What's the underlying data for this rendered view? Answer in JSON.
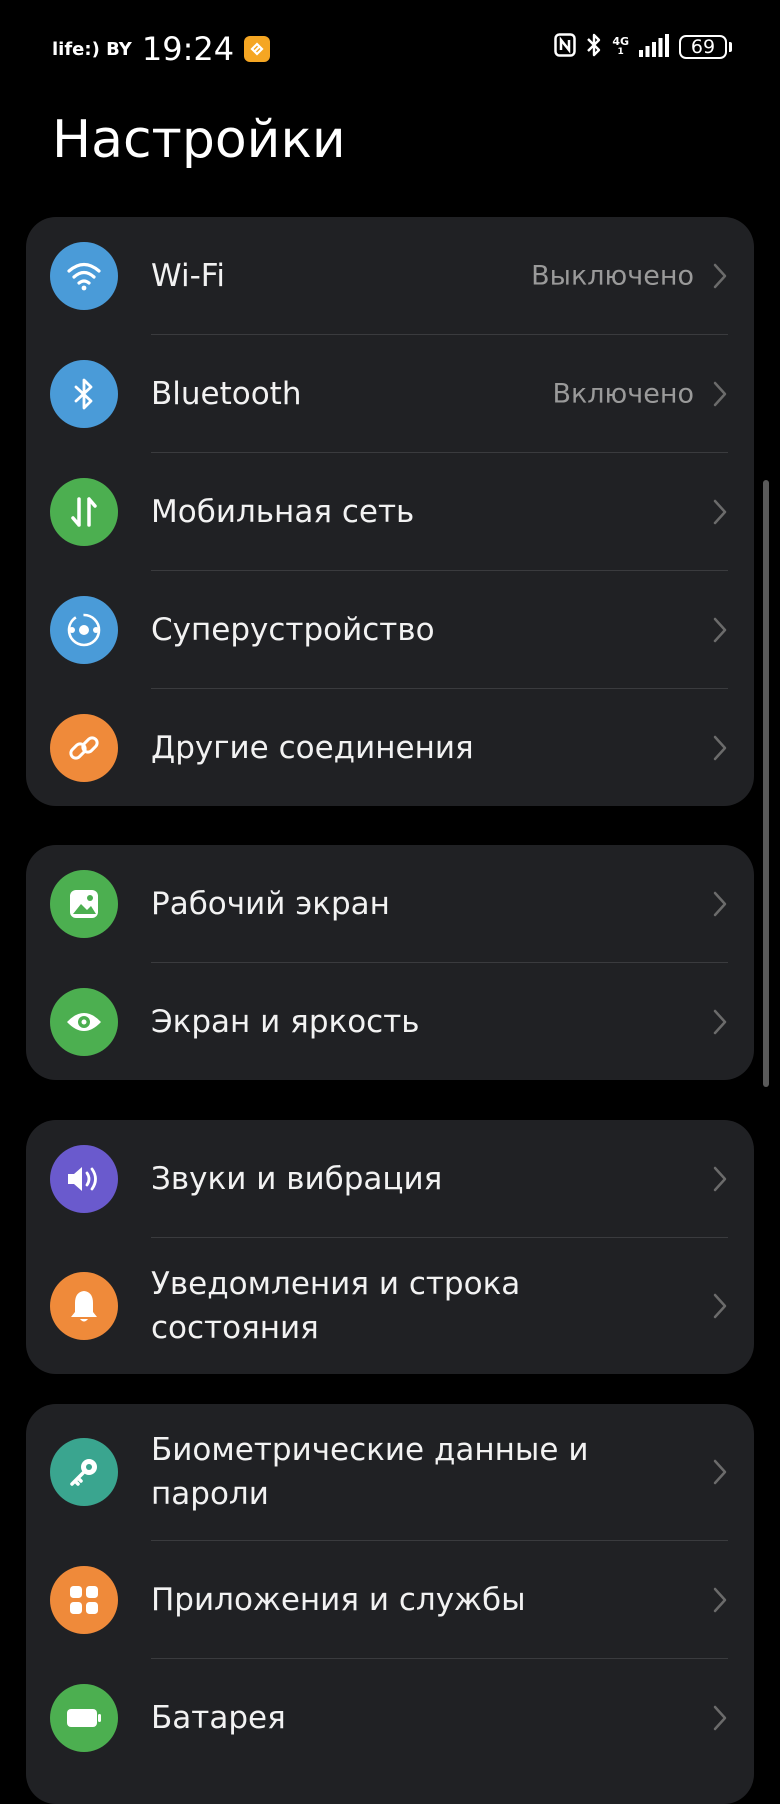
{
  "status_bar": {
    "carrier": "life:) BY",
    "time": "19:24",
    "network_type": "4G",
    "network_sub": "1",
    "battery_level": "69"
  },
  "page_title": "Настройки",
  "groups": [
    {
      "items": [
        {
          "label": "Wi-Fi",
          "value": "Выключено",
          "icon": "wifi-icon",
          "color": "#4a9bd8"
        },
        {
          "label": "Bluetooth",
          "value": "Включено",
          "icon": "bluetooth-icon",
          "color": "#4a9bd8"
        },
        {
          "label": "Мобильная сеть",
          "value": "",
          "icon": "mobile-data-icon",
          "color": "#4caf50"
        },
        {
          "label": "Суперустройство",
          "value": "",
          "icon": "super-device-icon",
          "color": "#4a9bd8"
        },
        {
          "label": "Другие соединения",
          "value": "",
          "icon": "link-icon",
          "color": "#ef8a3a"
        }
      ]
    },
    {
      "items": [
        {
          "label": "Рабочий экран",
          "value": "",
          "icon": "wallpaper-icon",
          "color": "#4caf50"
        },
        {
          "label": "Экран и яркость",
          "value": "",
          "icon": "eye-icon",
          "color": "#4caf50"
        }
      ]
    },
    {
      "items": [
        {
          "label": "Звуки и вибрация",
          "value": "",
          "icon": "sound-icon",
          "color": "#6a5acd"
        },
        {
          "label": "Уведомления и строка состояния",
          "value": "",
          "icon": "bell-icon",
          "color": "#ef8a3a"
        }
      ]
    },
    {
      "items": [
        {
          "label": "Биометрические данные и пароли",
          "value": "",
          "icon": "key-icon",
          "color": "#3aa58f"
        },
        {
          "label": "Приложения и службы",
          "value": "",
          "icon": "apps-icon",
          "color": "#ef8a3a"
        },
        {
          "label": "Батарея",
          "value": "",
          "icon": "battery-icon",
          "color": "#4caf50"
        }
      ]
    }
  ]
}
